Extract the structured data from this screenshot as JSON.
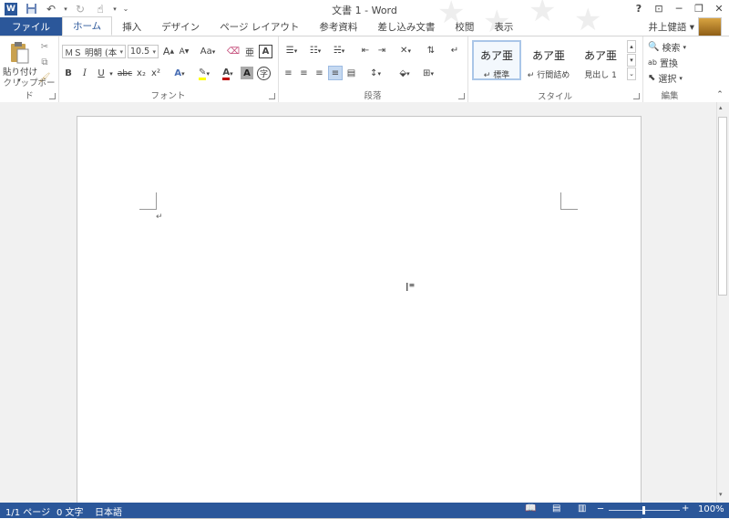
{
  "app": {
    "title": "文書 1 - Word",
    "logo_letter": "W"
  },
  "qat": {
    "icons": [
      "word-logo-icon",
      "save-icon",
      "undo-icon",
      "redo-icon",
      "touch-mode-icon",
      "customize-qat-icon"
    ]
  },
  "window_controls": {
    "help": "?",
    "ribbon_display": "⊡",
    "minimize": "─",
    "restore": "❐",
    "close": "✕"
  },
  "tabs": [
    {
      "label": "ファイル"
    },
    {
      "label": "ホーム"
    },
    {
      "label": "挿入"
    },
    {
      "label": "デザイン"
    },
    {
      "label": "ページ レイアウト"
    },
    {
      "label": "参考資料"
    },
    {
      "label": "差し込み文書"
    },
    {
      "label": "校閲"
    },
    {
      "label": "表示"
    }
  ],
  "user": {
    "name": "井上健語 ▾"
  },
  "ribbon": {
    "clipboard": {
      "label": "クリップボード",
      "paste": "貼り付け"
    },
    "font": {
      "label": "フォント",
      "font_name": "ＭＳ 明朝 (本",
      "font_size": "10.5",
      "grow": "A",
      "shrink": "A",
      "case": "Aa",
      "bold": "B",
      "italic": "I",
      "underline": "U",
      "strike": "abc",
      "sub": "x₂",
      "sup": "x²"
    },
    "paragraph": {
      "label": "段落"
    },
    "styles": {
      "label": "スタイル",
      "items": [
        {
          "sample": "あア亜",
          "name": "↵ 標準"
        },
        {
          "sample": "あア亜",
          "name": "↵ 行間詰め"
        },
        {
          "sample": "あア亜",
          "name": "見出し 1"
        }
      ]
    },
    "editing": {
      "label": "編集",
      "find": "検索",
      "replace": "置換",
      "select": "選択"
    }
  },
  "document": {
    "paragraph_mark": "↵"
  },
  "status": {
    "page": "1/1 ページ",
    "words": "0 文字",
    "language": "日本語",
    "zoom": "100%",
    "zoom_minus": "─",
    "zoom_plus": "+"
  },
  "colors": {
    "accent": "#2b579a",
    "highlight": "#ffff00",
    "font_color": "#c00000"
  }
}
